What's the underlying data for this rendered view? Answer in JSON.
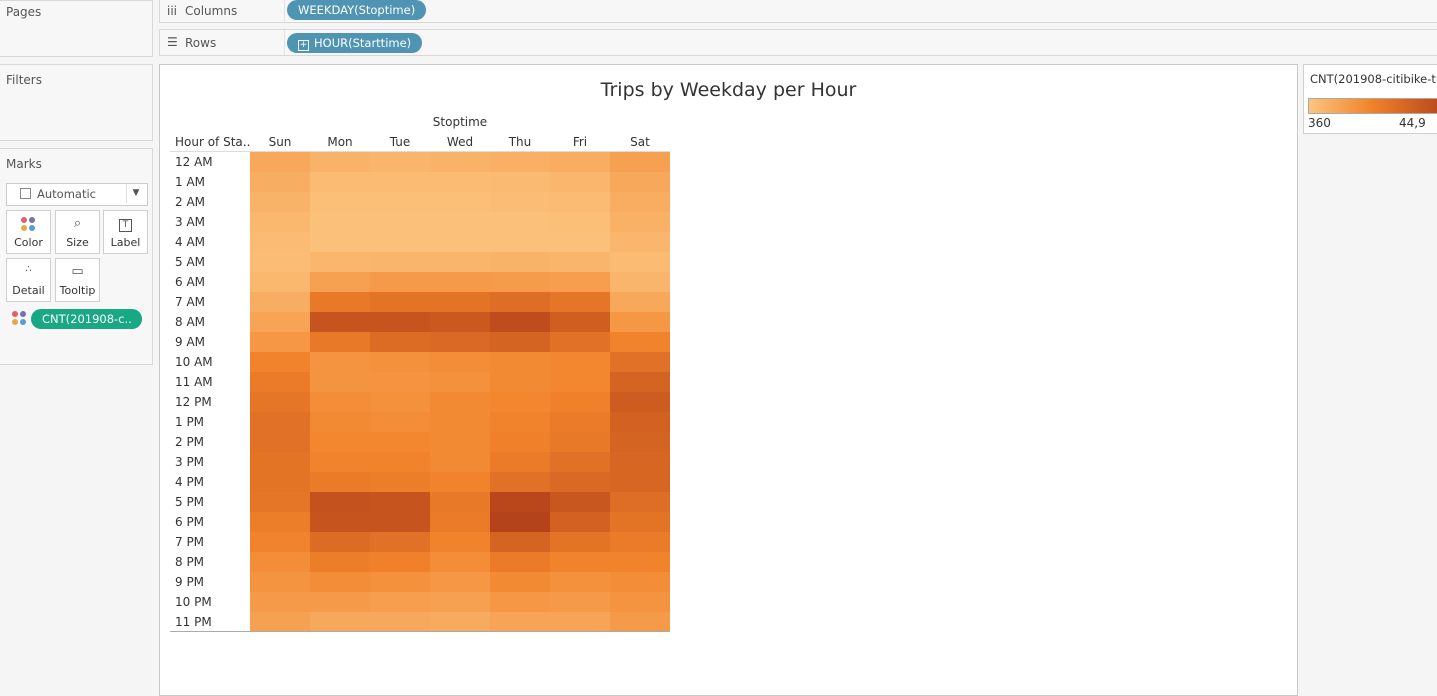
{
  "pages": {
    "title": "Pages"
  },
  "filters": {
    "title": "Filters"
  },
  "columns_shelf": {
    "label": "Columns",
    "pill": "WEEKDAY(Stoptime)"
  },
  "rows_shelf": {
    "label": "Rows",
    "pill": "HOUR(Starttime)"
  },
  "marks": {
    "title": "Marks",
    "type": "Automatic",
    "buttons": {
      "color": "Color",
      "size": "Size",
      "label": "Label",
      "detail": "Detail",
      "tooltip": "Tooltip"
    },
    "color_field": "CNT(201908-c.."
  },
  "colors": {
    "accent_pill": "#4f94b3",
    "measure_pill": "#18a884",
    "ramp_low": "#fcc47e",
    "ramp_high": "#b4421a"
  },
  "icons": {
    "columns": "columns-icon",
    "rows": "rows-icon",
    "mark_type": "square-icon",
    "dropdown": "chevron-down-icon"
  },
  "legend": {
    "title": "CNT(201908-citibike-tr",
    "min": "360",
    "max": "44,9"
  },
  "chart_data": {
    "type": "heatmap",
    "title": "Trips by Weekday per Hour",
    "column_header": "Stoptime",
    "row_header": "Hour of Sta..",
    "columns": [
      "Sun",
      "Mon",
      "Tue",
      "Wed",
      "Thu",
      "Fri",
      "Sat"
    ],
    "rows": [
      "12 AM",
      "1 AM",
      "2 AM",
      "3 AM",
      "4 AM",
      "5 AM",
      "6 AM",
      "7 AM",
      "8 AM",
      "9 AM",
      "10 AM",
      "11 AM",
      "12 PM",
      "1 PM",
      "2 PM",
      "3 PM",
      "4 PM",
      "5 PM",
      "6 PM",
      "7 PM",
      "8 PM",
      "9 PM",
      "10 PM",
      "11 PM"
    ],
    "values": [
      [
        9000,
        5500,
        5000,
        5500,
        6500,
        7500,
        11000
      ],
      [
        7000,
        3000,
        3000,
        3000,
        3500,
        4500,
        9000
      ],
      [
        5500,
        2000,
        2000,
        2000,
        2500,
        3000,
        7500
      ],
      [
        4000,
        1500,
        1500,
        1500,
        1500,
        2000,
        6000
      ],
      [
        3000,
        1500,
        1500,
        1500,
        1500,
        1500,
        4500
      ],
      [
        2500,
        4500,
        5000,
        5000,
        5500,
        5000,
        3000
      ],
      [
        4000,
        11000,
        13000,
        13000,
        12500,
        12000,
        5000
      ],
      [
        7000,
        24000,
        26000,
        26000,
        28000,
        25000,
        9000
      ],
      [
        10000,
        38000,
        38000,
        36000,
        41000,
        34000,
        14000
      ],
      [
        14000,
        24000,
        29000,
        30000,
        32000,
        27000,
        20000
      ],
      [
        20000,
        15000,
        16000,
        17000,
        18000,
        19000,
        27000
      ],
      [
        23000,
        15000,
        15000,
        16000,
        18000,
        19000,
        32000
      ],
      [
        25000,
        17000,
        16000,
        18000,
        19000,
        21000,
        35000
      ],
      [
        27000,
        18000,
        17000,
        18000,
        20000,
        23000,
        33000
      ],
      [
        27000,
        19000,
        19000,
        18000,
        21000,
        24000,
        32000
      ],
      [
        26000,
        20000,
        20000,
        18000,
        23000,
        27000,
        31000
      ],
      [
        26000,
        23000,
        22000,
        20000,
        27000,
        30000,
        31000
      ],
      [
        25000,
        39000,
        38000,
        24000,
        43000,
        37000,
        28000
      ],
      [
        22000,
        38000,
        38000,
        23000,
        45000,
        33000,
        26000
      ],
      [
        20000,
        29000,
        27000,
        20000,
        32000,
        26000,
        23000
      ],
      [
        17000,
        22000,
        21000,
        17000,
        23000,
        20000,
        20000
      ],
      [
        15000,
        17000,
        16000,
        14000,
        18000,
        16000,
        17000
      ],
      [
        13000,
        13000,
        12000,
        11000,
        14000,
        13000,
        15000
      ],
      [
        11000,
        9000,
        9000,
        8000,
        10000,
        10000,
        13000
      ]
    ]
  }
}
